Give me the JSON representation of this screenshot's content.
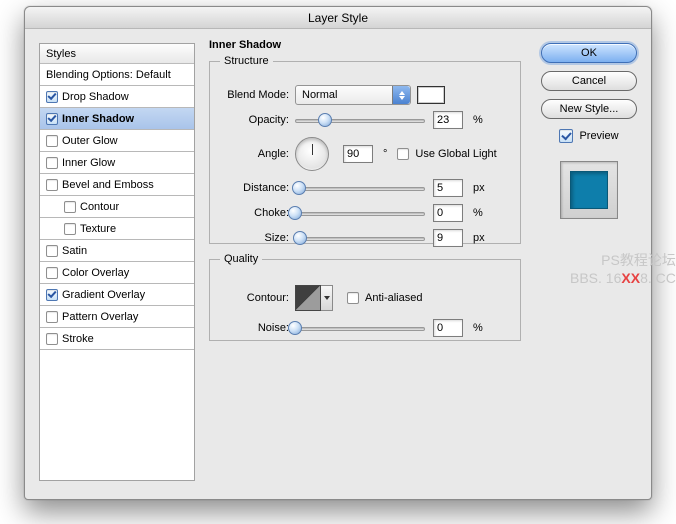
{
  "window": {
    "title": "Layer Style"
  },
  "sidebar": {
    "header": "Styles",
    "blending": "Blending Options: Default",
    "items": [
      {
        "label": "Drop Shadow",
        "checked": true,
        "selected": false
      },
      {
        "label": "Inner Shadow",
        "checked": true,
        "selected": true
      },
      {
        "label": "Outer Glow",
        "checked": false,
        "selected": false
      },
      {
        "label": "Inner Glow",
        "checked": false,
        "selected": false
      },
      {
        "label": "Bevel and Emboss",
        "checked": false,
        "selected": false
      },
      {
        "label": "Contour",
        "checked": false,
        "selected": false,
        "sub": true
      },
      {
        "label": "Texture",
        "checked": false,
        "selected": false,
        "sub": true
      },
      {
        "label": "Satin",
        "checked": false,
        "selected": false
      },
      {
        "label": "Color Overlay",
        "checked": false,
        "selected": false
      },
      {
        "label": "Gradient Overlay",
        "checked": true,
        "selected": false
      },
      {
        "label": "Pattern Overlay",
        "checked": false,
        "selected": false
      },
      {
        "label": "Stroke",
        "checked": false,
        "selected": false
      }
    ]
  },
  "panel": {
    "title": "Inner Shadow",
    "structure": {
      "legend": "Structure",
      "blend_label": "Blend Mode:",
      "blend_value": "Normal",
      "color": "#ffffff",
      "opacity_label": "Opacity:",
      "opacity_pct": 23,
      "opacity_value": "23",
      "angle_label": "Angle:",
      "angle_value": "90",
      "angle_unit": "°",
      "use_global_label": "Use Global Light",
      "use_global_checked": false,
      "distance_label": "Distance:",
      "distance_pct": 3,
      "distance_value": "5",
      "distance_unit": "px",
      "choke_label": "Choke:",
      "choke_pct": 0,
      "choke_value": "0",
      "choke_unit": "%",
      "size_label": "Size:",
      "size_pct": 4,
      "size_value": "9",
      "size_unit": "px"
    },
    "quality": {
      "legend": "Quality",
      "contour_label": "Contour:",
      "aa_label": "Anti-aliased",
      "aa_checked": false,
      "noise_label": "Noise:",
      "noise_pct": 0,
      "noise_value": "0",
      "noise_unit": "%"
    }
  },
  "buttons": {
    "ok": "OK",
    "cancel": "Cancel",
    "new_style": "New Style...",
    "preview_label": "Preview",
    "preview_checked": true,
    "preview_color": "#0e7eab"
  },
  "watermark": {
    "line1": "PS教程论坛",
    "line2_a": "BBS. 16",
    "line2_b": "XX",
    "line2_c": "8. CC"
  }
}
